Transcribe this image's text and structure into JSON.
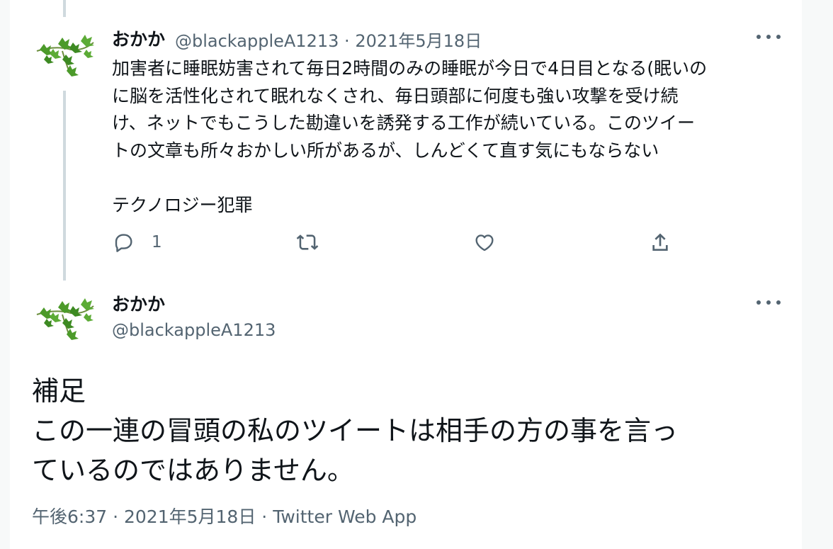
{
  "thread_tweet": {
    "display_name": "おかか",
    "handle": "@blackappleA1213",
    "separator": "·",
    "date": "2021年5月18日",
    "lines": [
      "加害者に睡眠妨害されて毎日2時間のみの睡眠が今日で4日目となる(眠いの",
      "に脳を活性化されて眠れなくされ、毎日頭部に何度も強い攻撃を受け続",
      "け、ネットでもこうした勘違いを誘発する工作が続いている。このツイー",
      "トの文章も所々おかしい所があるが、しんどくて直す気にもならない"
    ],
    "hashtag_line": "テクノロジー犯罪",
    "actions": {
      "reply_icon": "reply-icon",
      "reply_count": "1",
      "retweet_icon": "retweet-icon",
      "like_icon": "like-icon",
      "share_icon": "share-icon"
    },
    "more_icon": "more-icon"
  },
  "main_tweet": {
    "display_name": "おかか",
    "handle": "@blackappleA1213",
    "more_icon": "more-icon",
    "lines": [
      "補足",
      "この一連の冒頭の私のツイートは相手の方の事を言っ",
      "ているのではありません。"
    ],
    "footer": {
      "time": "午後6:37",
      "separator": "·",
      "date": "2021年5月18日",
      "separator2": "·",
      "source": "Twitter Web App"
    }
  },
  "colors": {
    "text_primary": "#0f1419",
    "text_secondary": "#536471",
    "thread_line": "#cfd9de",
    "avatar_leaf": "#4c9a2a"
  }
}
